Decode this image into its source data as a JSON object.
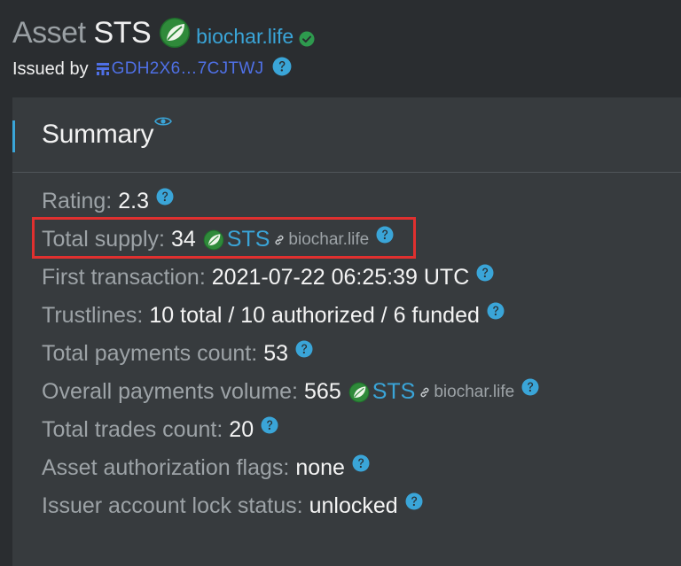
{
  "header": {
    "title_prefix": "Asset",
    "asset_code": "STS",
    "domain": "biochar.life",
    "issuer_label": "Issued by",
    "issuer_address": "GDH2X6…7CJTWJ"
  },
  "summary": {
    "title": "Summary",
    "rows": [
      {
        "label": "Rating:",
        "value": "2.3"
      },
      {
        "label": "Total supply:",
        "value": "34",
        "asset_code": "STS",
        "asset_domain": "biochar.life"
      },
      {
        "label": "First transaction:",
        "value": "2021-07-22 06:25:39 UTC"
      },
      {
        "label": "Trustlines:",
        "value": "10 total / 10 authorized / 6 funded"
      },
      {
        "label": "Total payments count:",
        "value": "53"
      },
      {
        "label": "Overall payments volume:",
        "value": "565",
        "asset_code": "STS",
        "asset_domain": "biochar.life"
      },
      {
        "label": "Total trades count:",
        "value": "20"
      },
      {
        "label": "Asset authorization flags:",
        "value": "none"
      },
      {
        "label": "Issuer account lock status:",
        "value": "unlocked"
      }
    ]
  },
  "icons": {
    "asset_logo": "leaf-logo-icon",
    "verified": "check-circle-icon",
    "issuer": "account-identicon-icon",
    "help": "question-circle-icon",
    "watch": "eye-icon",
    "link": "link-icon"
  },
  "colors": {
    "background": "#2a2d30",
    "panel": "#373b3e",
    "accent_blue": "#3aa5d8",
    "issuer_link": "#4f70e6",
    "verified_green": "#2e9a4e",
    "highlight_red": "#e0302f",
    "label_gray": "#9da3a7"
  }
}
